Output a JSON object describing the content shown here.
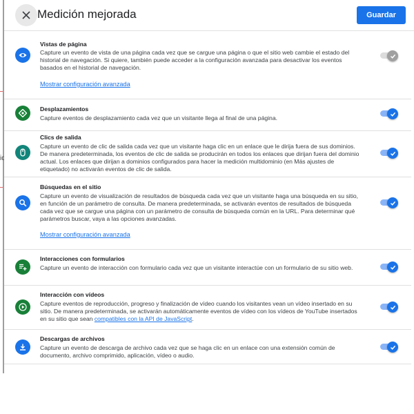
{
  "dialog": {
    "title": "Medición mejorada",
    "save_label": "Guardar"
  },
  "background_text": "id",
  "sections": [
    {
      "title": "Vistas de página",
      "description": "Capture un evento de vista de una página cada vez que se cargue una página o que el sitio web cambie el estado del historial de navegación. Si quiere, también puede acceder a la configuración avanzada para desactivar los eventos basados en el historial de navegación.",
      "link": "Mostrar configuración avanzada",
      "icon": "eye-icon",
      "icon_color": "#1a73e8",
      "enabled": false
    },
    {
      "title": "Desplazamientos",
      "description": "Capture eventos de desplazamiento cada vez que un visitante llega al final de una página.",
      "icon": "crosshair-icon",
      "icon_color": "#188038",
      "enabled": true
    },
    {
      "title": "Clics de salida",
      "description": "Capture un evento de clic de salida cada vez que un visitante haga clic en un enlace que le dirija fuera de sus dominios. De manera predeterminada, los eventos de clic de salida se producirán en todos los enlaces que dirijan fuera del dominio actual. Los enlaces que dirijan a dominios configurados para hacer la medición multidominio (en Más ajustes de etiquetado) no activarán eventos de clic de salida.",
      "icon": "mouse-icon",
      "icon_color": "#12857a",
      "enabled": true
    },
    {
      "title": "Búsquedas en el sitio",
      "description": "Capture un evento de visualización de resultados de búsqueda cada vez que un visitante haga una búsqueda en su sitio, en función de un parámetro de consulta. De manera predeterminada, se activarán eventos de resultados de búsqueda cada vez que se cargue una página con un parámetro de consulta de búsqueda común en la URL. Para determinar qué parámetros buscar, vaya a las opciones avanzadas.",
      "link": "Mostrar configuración avanzada",
      "icon": "search-icon",
      "icon_color": "#1a73e8",
      "enabled": true
    },
    {
      "title": "Interacciones con formularios",
      "description": "Capture un evento de interacción con formulario cada vez que un visitante interactúe con un formulario de su sitio web.",
      "icon": "form-icon",
      "icon_color": "#188038",
      "enabled": true
    },
    {
      "title": "Interacción con vídeos",
      "description_before": "Capture eventos de reproducción, progreso y finalización de vídeo cuando los visitantes vean un vídeo insertado en su sitio. De manera predeterminada, se activarán automáticamente eventos de vídeo con los vídeos de YouTube insertados en su sitio que sean ",
      "description_link": "compatibles con la API de JavaScript",
      "description_after": ".",
      "icon": "play-icon",
      "icon_color": "#188038",
      "enabled": true
    },
    {
      "title": "Descargas de archivos",
      "description": "Capture un evento de descarga de archivo cada vez que se haga clic en un enlace con una extensión común de documento, archivo comprimido, aplicación, vídeo o audio.",
      "icon": "download-icon",
      "icon_color": "#1a73e8",
      "enabled": true
    }
  ]
}
